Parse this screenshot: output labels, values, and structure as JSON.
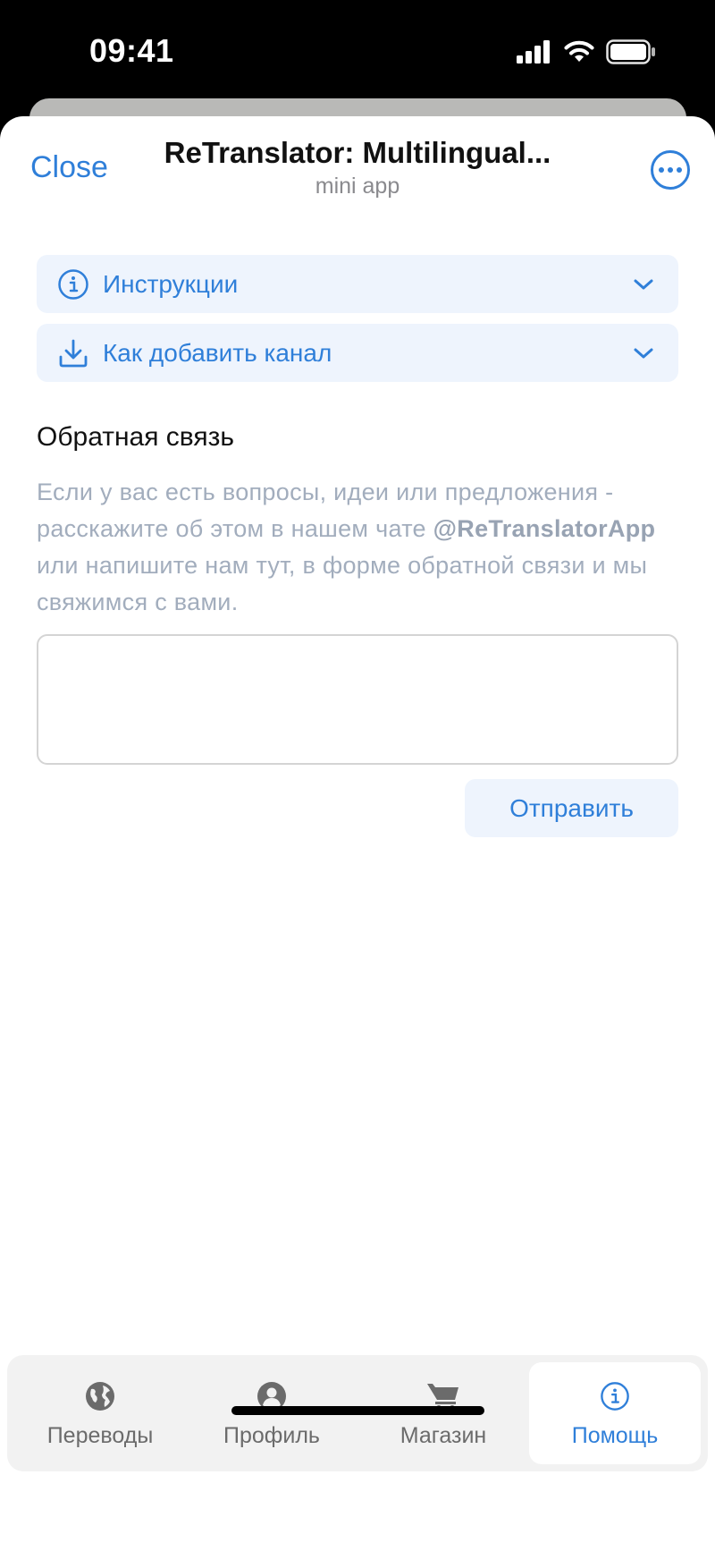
{
  "status_bar": {
    "time": "09:41"
  },
  "header": {
    "close_label": "Close",
    "title": "ReTranslator: Multilingual...",
    "subtitle": "mini app"
  },
  "accordions": [
    {
      "label": "Инструкции",
      "icon": "info-icon"
    },
    {
      "label": "Как добавить канал",
      "icon": "download-icon"
    }
  ],
  "feedback": {
    "title": "Обратная связь",
    "desc_part1": "Если у вас есть вопросы, идеи или предложения - расскажите об этом в нашем чате ",
    "desc_handle": "@ReTranslatorApp",
    "desc_part2": " или напишите нам тут, в форме обратной связи и мы свяжимся с вами.",
    "input_value": "",
    "send_label": "Отправить"
  },
  "tabbar": {
    "tabs": [
      {
        "label": "Переводы",
        "icon": "globe-icon",
        "active": false
      },
      {
        "label": "Профиль",
        "icon": "user-icon",
        "active": false
      },
      {
        "label": "Магазин",
        "icon": "cart-icon",
        "active": false
      },
      {
        "label": "Помощь",
        "icon": "info-icon",
        "active": true
      }
    ]
  },
  "colors": {
    "accent": "#2f7fd9",
    "accent_bg": "#eef4fd",
    "muted_text": "#a2adbd"
  }
}
